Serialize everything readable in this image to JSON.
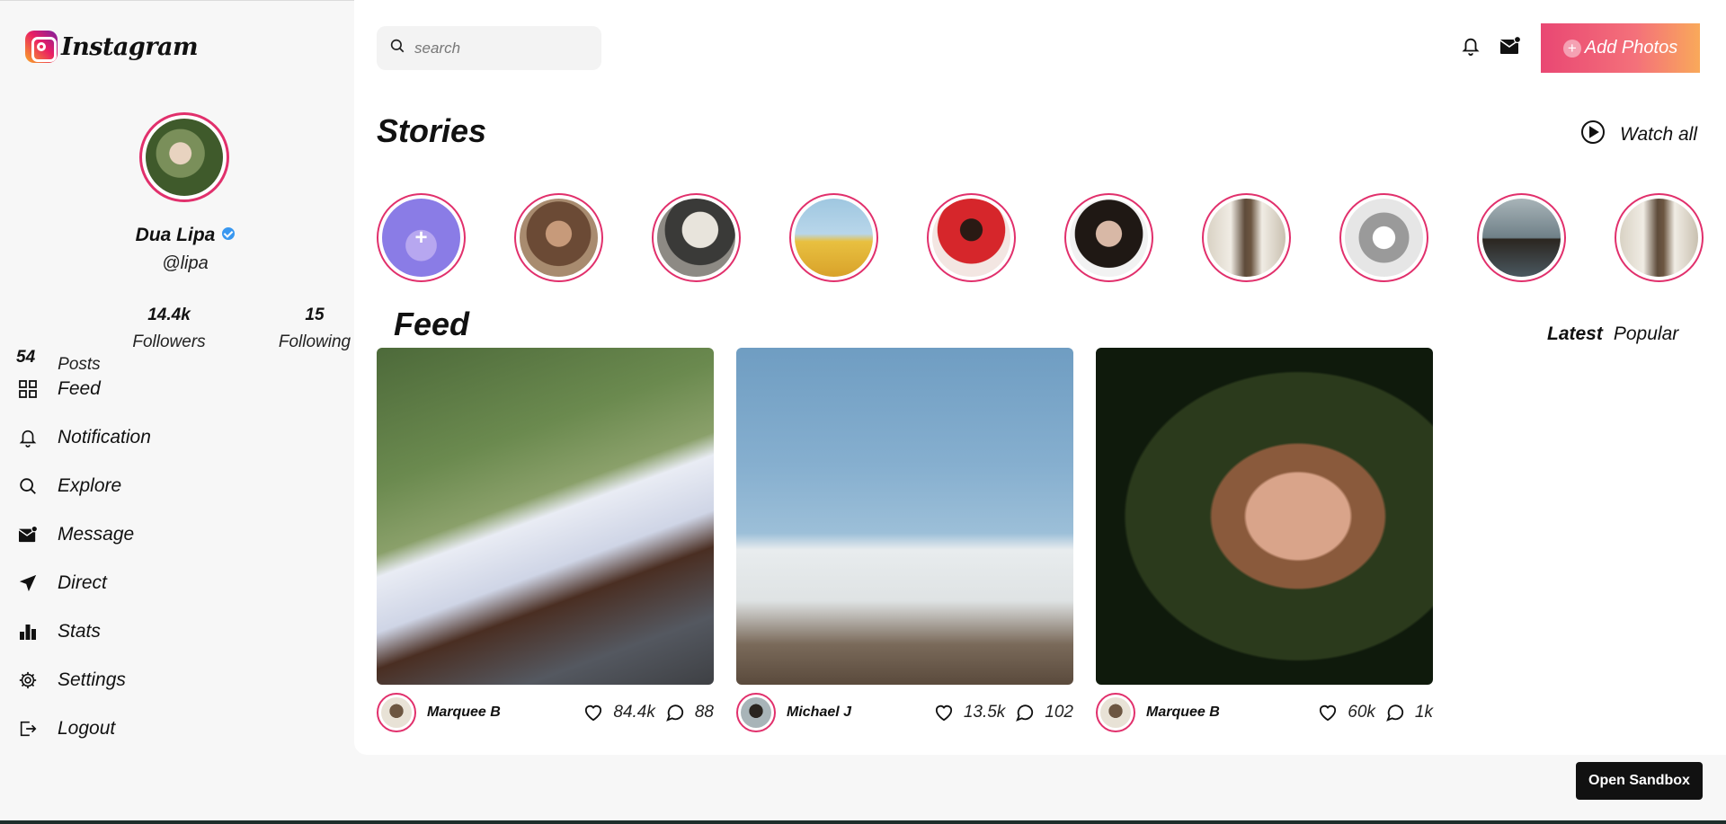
{
  "brand": {
    "name": "Instagram",
    "logo_icon": "instagram-logo-icon"
  },
  "profile": {
    "name": "Dua Lipa",
    "handle": "@lipa",
    "verified": true,
    "stats": [
      {
        "value": "54",
        "label": "Posts"
      },
      {
        "value": "14.4k",
        "label": "Followers"
      },
      {
        "value": "15",
        "label": "Following"
      }
    ]
  },
  "nav": [
    {
      "label": "Feed",
      "icon": "grid-icon"
    },
    {
      "label": "Notification",
      "icon": "bell-icon"
    },
    {
      "label": "Explore",
      "icon": "search-icon"
    },
    {
      "label": "Message",
      "icon": "mail-icon"
    },
    {
      "label": "Direct",
      "icon": "send-icon"
    },
    {
      "label": "Stats",
      "icon": "bar-chart-icon"
    },
    {
      "label": "Settings",
      "icon": "gear-icon"
    },
    {
      "label": "Logout",
      "icon": "logout-icon"
    }
  ],
  "header": {
    "search_placeholder": "search",
    "add_photos_label": "Add Photos",
    "colors": {
      "accent_start": "#e94773",
      "accent_end": "#f9a95a",
      "story_ring": "#e1306c"
    }
  },
  "stories": {
    "title": "Stories",
    "watch_all_label": "Watch all",
    "items": [
      {
        "kind": "add",
        "label": "+"
      },
      {
        "kind": "story"
      },
      {
        "kind": "story"
      },
      {
        "kind": "story"
      },
      {
        "kind": "story"
      },
      {
        "kind": "story"
      },
      {
        "kind": "story"
      },
      {
        "kind": "story"
      },
      {
        "kind": "story"
      },
      {
        "kind": "story"
      }
    ]
  },
  "feed": {
    "title": "Feed",
    "tabs": [
      {
        "label": "Latest",
        "active": true
      },
      {
        "label": "Popular",
        "active": false
      }
    ],
    "posts": [
      {
        "author": "Marquee B",
        "likes": "84.4k",
        "comments": "88"
      },
      {
        "author": "Michael J",
        "likes": "13.5k",
        "comments": "102"
      },
      {
        "author": "Marquee B",
        "likes": "60k",
        "comments": "1k"
      }
    ]
  },
  "footer": {
    "open_sandbox_label": "Open Sandbox"
  }
}
